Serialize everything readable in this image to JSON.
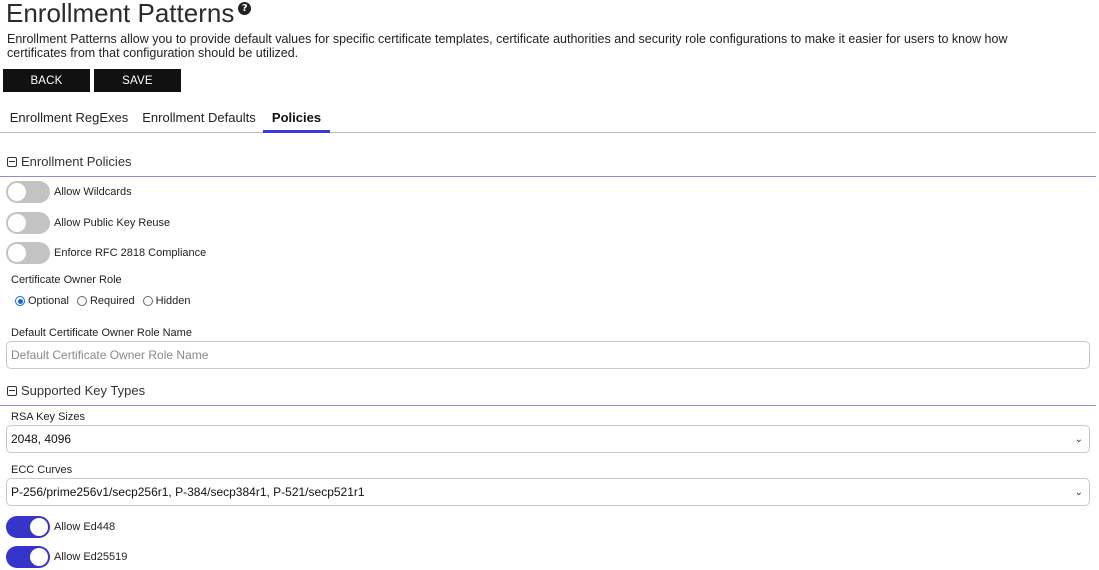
{
  "page": {
    "title": "Enrollment Patterns",
    "help_icon": "question-circle-icon",
    "description": "Enrollment Patterns allow you to provide default values for specific certificate templates, certificate authorities and security role configurations to make it easier for users to know how certificates from that configuration should be utilized."
  },
  "buttons": {
    "back": "BACK",
    "save": "SAVE"
  },
  "tabs": [
    {
      "label": "Enrollment RegExes",
      "active": false
    },
    {
      "label": "Enrollment Defaults",
      "active": false
    },
    {
      "label": "Policies",
      "active": true
    }
  ],
  "enrollment_policies": {
    "heading": "Enrollment Policies",
    "toggles": [
      {
        "label": "Allow Wildcards",
        "on": false
      },
      {
        "label": "Allow Public Key Reuse",
        "on": false
      },
      {
        "label": "Enforce RFC 2818 Compliance",
        "on": false
      }
    ],
    "owner_role_label": "Certificate Owner Role",
    "owner_role_options": [
      {
        "label": "Optional",
        "checked": true
      },
      {
        "label": "Required",
        "checked": false
      },
      {
        "label": "Hidden",
        "checked": false
      }
    ],
    "default_owner_label": "Default Certificate Owner Role Name",
    "default_owner_placeholder": "Default Certificate Owner Role Name",
    "default_owner_value": ""
  },
  "supported_key_types": {
    "heading": "Supported Key Types",
    "rsa_label": "RSA Key Sizes",
    "rsa_value": "2048, 4096",
    "ecc_label": "ECC Curves",
    "ecc_value": "P-256/prime256v1/secp256r1, P-384/secp384r1, P-521/secp521r1",
    "toggles": [
      {
        "label": "Allow Ed448",
        "on": true
      },
      {
        "label": "Allow Ed25519",
        "on": true
      }
    ]
  },
  "colors": {
    "accent": "#3535c9",
    "button_bg": "#111111",
    "toggle_off": "#c3c3c3"
  }
}
